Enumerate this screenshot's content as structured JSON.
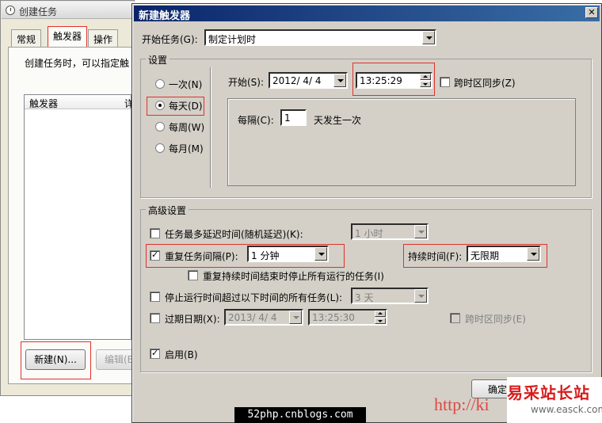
{
  "background_window": {
    "title": "创建任务",
    "tabs": [
      "常规",
      "触发器",
      "操作"
    ],
    "description": "创建任务时，可以指定触",
    "list_columns": [
      "触发器",
      "详"
    ],
    "new_button": "新建(N)...",
    "edit_button": "编辑(E"
  },
  "dialog": {
    "title": "新建触发器",
    "close": "✕",
    "begin_task_label": "开始任务(G):",
    "begin_task_value": "制定计划时",
    "settings": {
      "caption": "设置",
      "radios": [
        {
          "label": "一次(N)",
          "selected": false
        },
        {
          "label": "每天(D)",
          "selected": true
        },
        {
          "label": "每周(W)",
          "selected": false
        },
        {
          "label": "每月(M)",
          "selected": false
        }
      ],
      "start_label": "开始(S):",
      "start_date": "2012/ 4/ 4",
      "start_time": "13:25:29",
      "sync_timezone": "跨时区同步(Z)",
      "every_label": "每隔(C):",
      "every_value": "1",
      "every_suffix": "天发生一次"
    },
    "advanced": {
      "caption": "高级设置",
      "delay_label": "任务最多延迟时间(随机延迟)(K):",
      "delay_value": "1 小时",
      "repeat_label": "重复任务间隔(P):",
      "repeat_value": "1 分钟",
      "duration_label": "持续时间(F):",
      "duration_value": "无限期",
      "stop_at_end_label": "重复持续时间结束时停止所有运行的任务(I)",
      "stop_longer_label": "停止运行时间超过以下时间的所有任务(L):",
      "stop_longer_value": "3 天",
      "expire_label": "过期日期(X):",
      "expire_date": "2013/ 4/ 4",
      "expire_time": "13:25:30",
      "expire_sync": "跨时区同步(E)",
      "enabled_label": "启用(B)"
    },
    "ok_button": "确定"
  },
  "watermarks": {
    "strip": "52php.cnblogs.com",
    "url": "http://ki",
    "logo_cn": "易采站长站",
    "logo_en": "www.easck.com"
  }
}
